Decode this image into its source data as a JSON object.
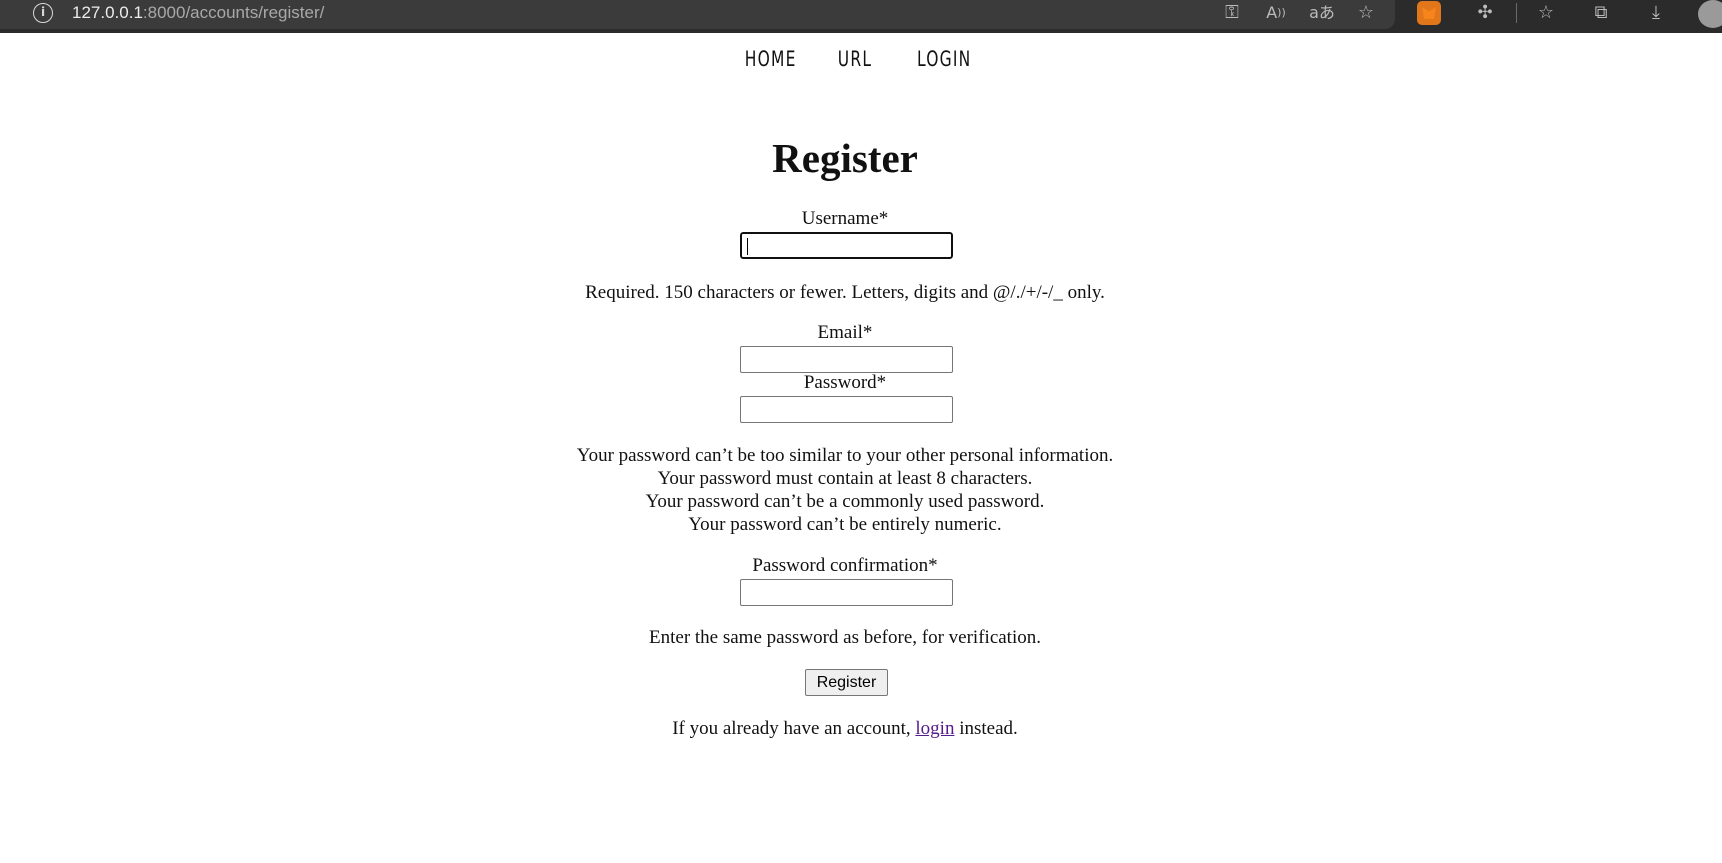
{
  "browser": {
    "url_host": "127.0.0.1",
    "url_path": ":8000/accounts/register/",
    "icons": [
      "info-icon",
      "key-icon",
      "read-aloud-icon",
      "translate-icon",
      "add-favorite-icon",
      "metamask-extension-icon",
      "extensions-icon",
      "favorites-icon",
      "collections-icon",
      "downloads-icon",
      "profile-avatar"
    ]
  },
  "nav": {
    "home": "HOME",
    "url": "URL",
    "login": "LOGIN"
  },
  "form": {
    "title": "Register",
    "username_label": "Username*",
    "username_value": "",
    "username_help": "Required. 150 characters or fewer. Letters, digits and @/./+/-/_ only.",
    "email_label": "Email*",
    "email_value": "",
    "password_label": "Password*",
    "password_value": "",
    "password_help": [
      "Your password can’t be too similar to your other personal information.",
      "Your password must contain at least 8 characters.",
      "Your password can’t be a commonly used password.",
      "Your password can’t be entirely numeric."
    ],
    "password2_label": "Password confirmation*",
    "password2_value": "",
    "password2_help": "Enter the same password as before, for verification.",
    "submit_label": "Register",
    "footer_before": "If you already have an account, ",
    "footer_link": "login",
    "footer_after": " instead."
  }
}
